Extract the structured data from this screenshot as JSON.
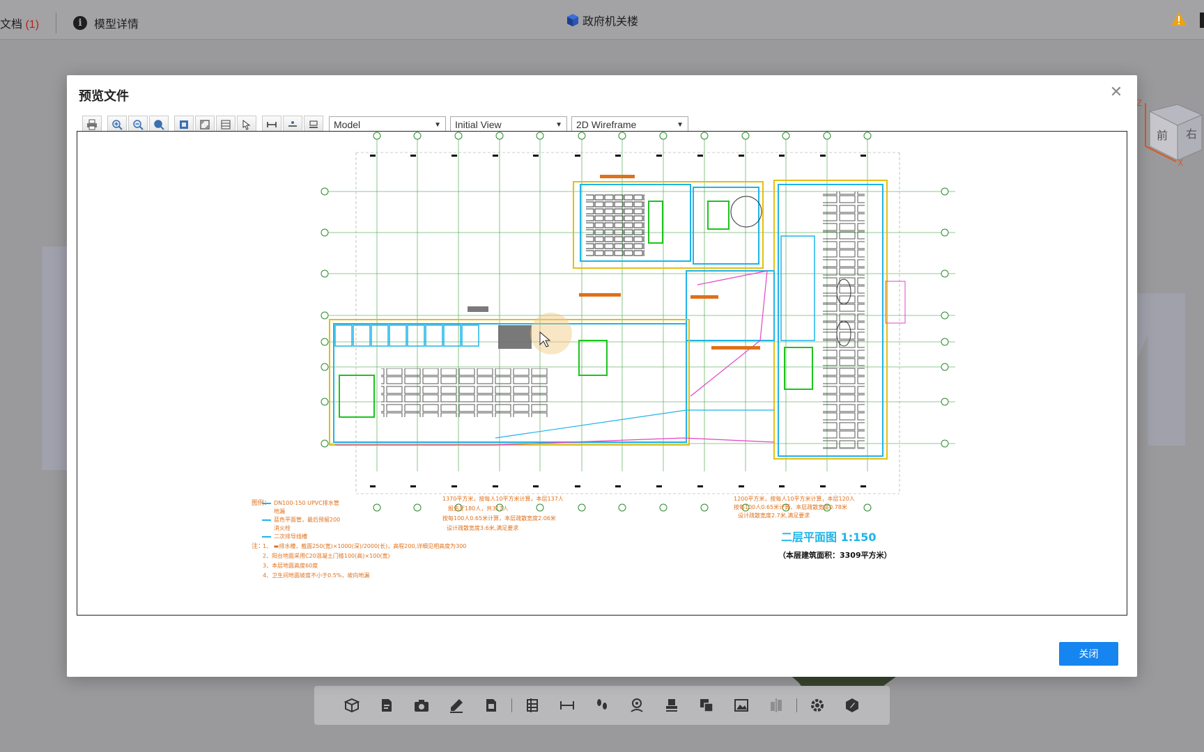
{
  "app": {
    "docs_label": "文档",
    "docs_count": "(1)",
    "model_details_label": "模型详情",
    "project_title": "政府机关楼"
  },
  "modal": {
    "title": "预览文件",
    "close_button_label": "关闭",
    "toolbar": {
      "layout_select": "Model",
      "view_select": "Initial View",
      "visual_style_select": "2D Wireframe"
    },
    "drawing": {
      "title": "二层平面图  1:150",
      "area_note": "（本层建筑面积：3309平方米）",
      "legend_heading": "图例：",
      "legend_items": [
        "DN100-150 UPVC排水管",
        "地漏",
        "蓝色平面管，最后预留200",
        "消火栓",
        "二次排导线槽"
      ],
      "notes_heading": "注：",
      "notes": [
        "1、 ▬排水槽，截面250(宽)×1000(深)/2000(长)，高程200,详细见相高度为300",
        "2、阳台地面采用C20混凝土门槛100(高)×100(宽)",
        "3、本层地面高度60度",
        "4、卫生间地面坡度不小于0.5%，坡向地漏"
      ],
      "center_note": [
        "1370平方米，按每人10平方米计算，本层137人",
        "报告厅180人，共317人",
        "按每100人0.65米计算，本层疏散宽度2.06米",
        "设计疏散宽度3.6米,满足要求"
      ],
      "right_note": [
        "1200平方米，按每人10平方米计算，本层120人",
        "按每100人0.65米计算，本层疏散宽度0.78米",
        "设计疏散宽度2.7米,满足要求"
      ]
    }
  },
  "icons": {
    "top": [
      "info-icon",
      "model-cube-icon",
      "warning-icon"
    ],
    "cad_toolbar": [
      "print-icon",
      "zoom-in-icon",
      "zoom-out-icon",
      "zoom-extents-icon",
      "zoom-window-icon",
      "fit-icon",
      "layers-icon",
      "select-icon",
      "measure-icon",
      "measure-point-icon",
      "measure-area-icon"
    ],
    "bottom_toolbar": [
      "model-cube-icon",
      "document-icon",
      "camera-icon",
      "markup-pen-icon",
      "sheet-icon",
      "section-icon",
      "measure-icon",
      "walk-icon",
      "location-icon",
      "stamp-icon",
      "copy-icon",
      "image-icon",
      "compare-icon",
      "settings-icon",
      "tag-icon"
    ]
  },
  "colors": {
    "primary_button": "#1685f0",
    "warning": "#e8a317",
    "cad_cyan": "#1fb4e8",
    "cad_magenta": "#e640c8",
    "cad_yellow": "#e3c010",
    "cad_green": "#1cc41c",
    "cad_orange": "#e0701a"
  }
}
